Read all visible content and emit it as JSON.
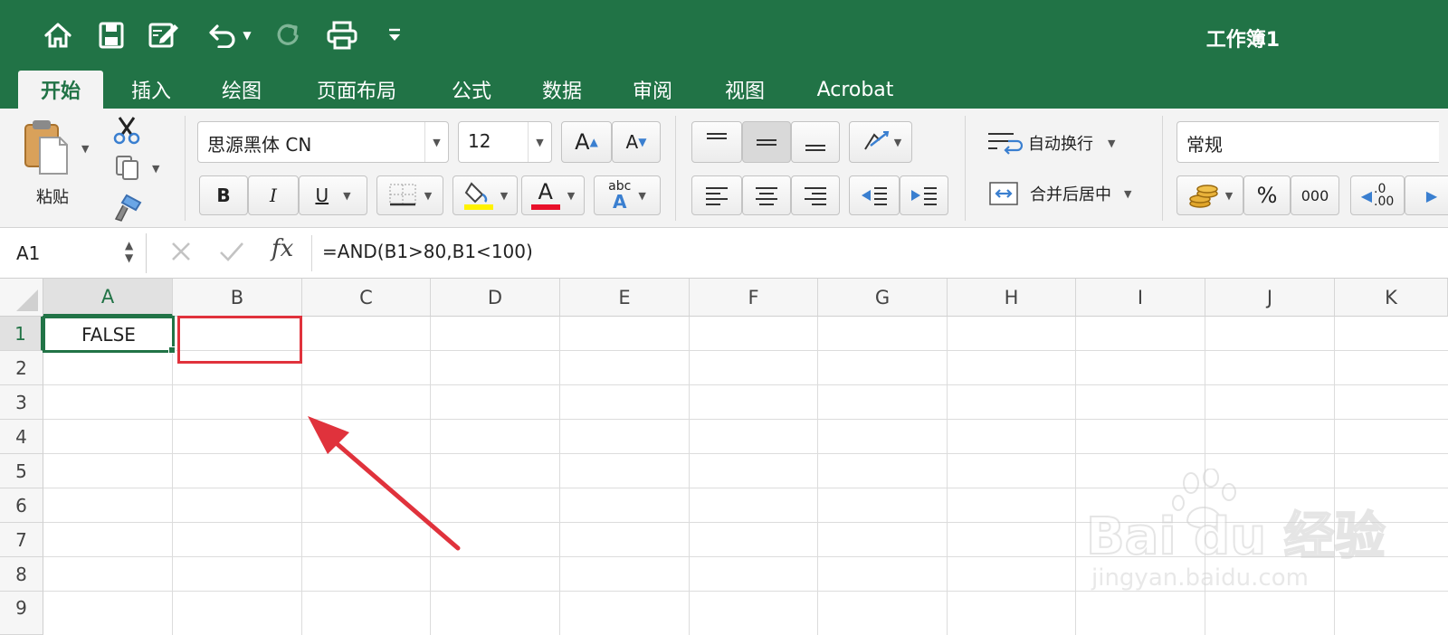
{
  "title_bar": {
    "document_title": "工作簿1",
    "quick_access": [
      "home-icon",
      "save-icon",
      "edit-doc-icon",
      "undo-icon",
      "redo-icon",
      "print-icon",
      "customize-icon"
    ]
  },
  "tabs": [
    {
      "label": "开始",
      "active": true
    },
    {
      "label": "插入"
    },
    {
      "label": "绘图"
    },
    {
      "label": "页面布局"
    },
    {
      "label": "公式"
    },
    {
      "label": "数据"
    },
    {
      "label": "审阅"
    },
    {
      "label": "视图"
    },
    {
      "label": "Acrobat"
    }
  ],
  "ribbon": {
    "paste_label": "粘贴",
    "font_name": "思源黑体 CN",
    "font_size": "12",
    "bold": "B",
    "italic": "I",
    "underline": "U",
    "grow_font": "A",
    "shrink_font": "A",
    "font_color_letter": "A",
    "spell_abc": "abc",
    "spell_A": "A",
    "wrap_text": "自动换行",
    "merge_center": "合并后居中",
    "number_format": "常规",
    "percent": "%",
    "thousands": "000",
    "dec_top": ".0",
    "dec_bottom": ".00"
  },
  "formula_bar": {
    "name_box": "A1",
    "fx": "fx",
    "formula": "=AND(B1>80,B1<100)"
  },
  "sheet": {
    "columns": [
      "A",
      "B",
      "C",
      "D",
      "E",
      "F",
      "G",
      "H",
      "I",
      "J",
      "K"
    ],
    "rows": [
      "1",
      "2",
      "3",
      "4",
      "5",
      "6",
      "7",
      "8",
      "9"
    ],
    "cell_A1": "FALSE"
  },
  "colors": {
    "excel_green": "#217346",
    "annotation_red": "#e0323c"
  },
  "watermark": {
    "brand": "Bai du 经验",
    "url": "jingyan.baidu.com"
  }
}
